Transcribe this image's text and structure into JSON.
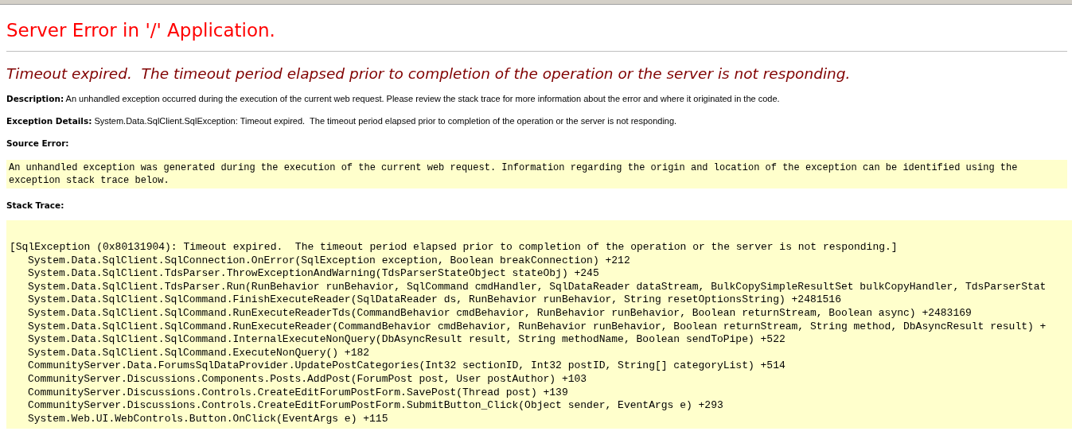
{
  "title": "Server Error in '/' Application.",
  "subtitle": "Timeout expired.  The timeout period elapsed prior to completion of the operation or the server is not responding.",
  "details": [
    {
      "label": "Description:",
      "text": "An unhandled exception occurred during the execution of the current web request. Please review the stack trace for more information about the error and where it originated in the code."
    },
    {
      "label": "Exception Details:",
      "text": "System.Data.SqlClient.SqlException: Timeout expired.  The timeout period elapsed prior to completion of the operation or the server is not responding."
    }
  ],
  "source_error": {
    "heading": "Source Error:",
    "text": "An unhandled exception was generated during the execution of the current web request. Information regarding the origin and location of the exception can be identified using the exception stack trace below."
  },
  "stack_trace": {
    "heading": "Stack Trace:",
    "lines": [
      {
        "kind": "exception",
        "text": "[SqlException (0x80131904): Timeout expired.  The timeout period elapsed prior to completion of the operation or the server is not responding.]"
      },
      {
        "kind": "frame",
        "text": "System.Data.SqlClient.SqlConnection.OnError(SqlException exception, Boolean breakConnection) +212"
      },
      {
        "kind": "frame",
        "text": "System.Data.SqlClient.TdsParser.ThrowExceptionAndWarning(TdsParserStateObject stateObj) +245"
      },
      {
        "kind": "frame",
        "text": "System.Data.SqlClient.TdsParser.Run(RunBehavior runBehavior, SqlCommand cmdHandler, SqlDataReader dataStream, BulkCopySimpleResultSet bulkCopyHandler, TdsParserStat"
      },
      {
        "kind": "frame",
        "text": "System.Data.SqlClient.SqlCommand.FinishExecuteReader(SqlDataReader ds, RunBehavior runBehavior, String resetOptionsString) +2481516"
      },
      {
        "kind": "frame",
        "text": "System.Data.SqlClient.SqlCommand.RunExecuteReaderTds(CommandBehavior cmdBehavior, RunBehavior runBehavior, Boolean returnStream, Boolean async) +2483169"
      },
      {
        "kind": "frame",
        "text": "System.Data.SqlClient.SqlCommand.RunExecuteReader(CommandBehavior cmdBehavior, RunBehavior runBehavior, Boolean returnStream, String method, DbAsyncResult result) +"
      },
      {
        "kind": "frame",
        "text": "System.Data.SqlClient.SqlCommand.InternalExecuteNonQuery(DbAsyncResult result, String methodName, Boolean sendToPipe) +522"
      },
      {
        "kind": "frame",
        "text": "System.Data.SqlClient.SqlCommand.ExecuteNonQuery() +182"
      },
      {
        "kind": "frame",
        "text": "CommunityServer.Data.ForumsSqlDataProvider.UpdatePostCategories(Int32 sectionID, Int32 postID, String[] categoryList) +514"
      },
      {
        "kind": "frame",
        "text": "CommunityServer.Discussions.Components.Posts.AddPost(ForumPost post, User postAuthor) +103"
      },
      {
        "kind": "frame",
        "text": "CommunityServer.Discussions.Controls.CreateEditForumPostForm.SavePost(Thread post) +139"
      },
      {
        "kind": "frame",
        "text": "CommunityServer.Discussions.Controls.CreateEditForumPostForm.SubmitButton_Click(Object sender, EventArgs e) +293"
      },
      {
        "kind": "frame",
        "text": "System.Web.UI.WebControls.Button.OnClick(EventArgs e) +115"
      }
    ]
  }
}
